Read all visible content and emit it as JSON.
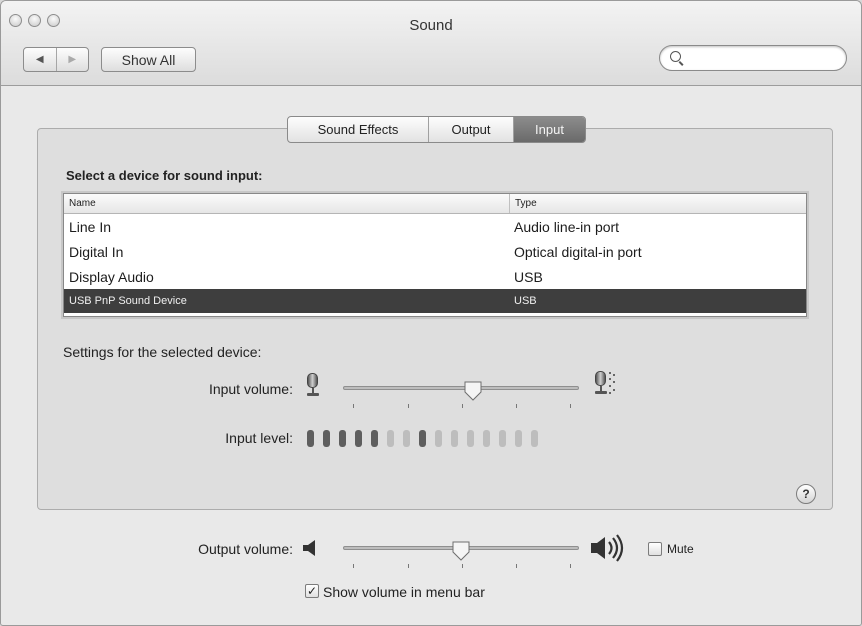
{
  "window": {
    "title": "Sound"
  },
  "toolbar": {
    "back_label": "◀",
    "forward_label": "▶",
    "show_all_label": "Show All",
    "search": {
      "value": "",
      "placeholder": ""
    }
  },
  "tabs": [
    {
      "label": "Sound Effects",
      "active": false
    },
    {
      "label": "Output",
      "active": false
    },
    {
      "label": "Input",
      "active": true
    }
  ],
  "input_panel": {
    "heading": "Select a device for sound input:",
    "columns": [
      "Name",
      "Type"
    ],
    "rows": [
      {
        "name": "Line In",
        "type": "Audio line-in port",
        "selected": false
      },
      {
        "name": "Digital In",
        "type": "Optical digital-in port",
        "selected": false
      },
      {
        "name": "Display Audio",
        "type": "USB",
        "selected": false
      },
      {
        "name": "USB PnP Sound Device",
        "type": "USB",
        "selected": true
      }
    ],
    "settings_label": "Settings for the selected device:",
    "input_volume_label": "Input volume:",
    "input_volume_level": 0.55,
    "input_level_label": "Input level:",
    "input_level_segments": 15,
    "input_level_active": [
      0,
      1,
      2,
      3,
      4,
      7
    ],
    "help_label": "?"
  },
  "output": {
    "volume_label": "Output volume:",
    "volume_level": 0.5,
    "mute_label": "Mute",
    "mute_checked": false,
    "show_volume_label": "Show volume in menu bar",
    "show_volume_checked": true
  },
  "colors": {
    "selected_row": "#3e3e3e",
    "active_tab": "#7a7a7a"
  }
}
